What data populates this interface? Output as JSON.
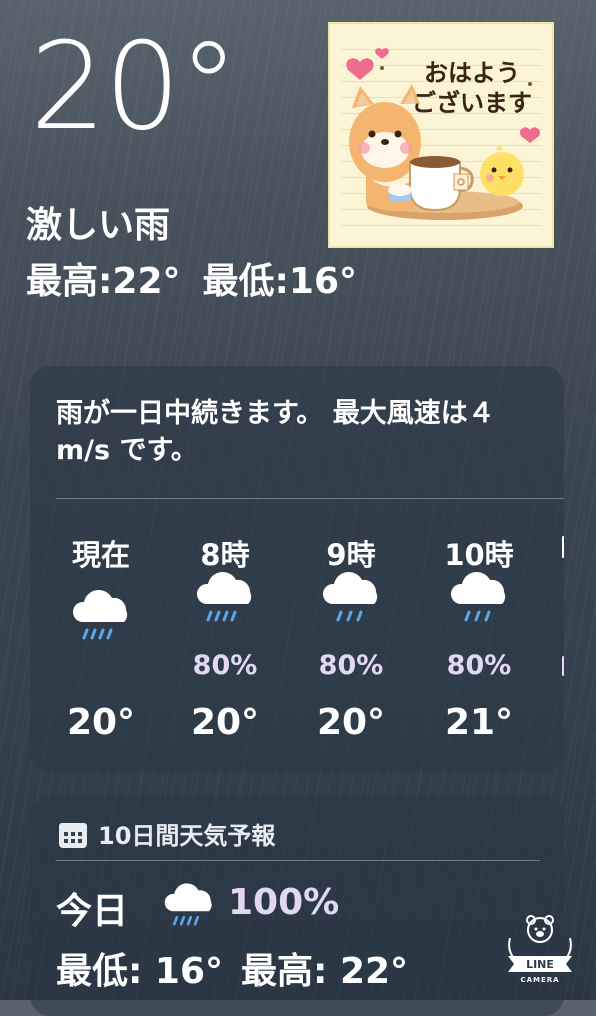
{
  "current": {
    "temperature": "20°",
    "condition": "激しい雨",
    "high": "最高:22°",
    "low": "最低:16°"
  },
  "sticker": {
    "line1": "おはよう",
    "line2": "ございます"
  },
  "summary": {
    "text": "雨が一日中続きます。 最大風速は４ m/s です。"
  },
  "hourly": [
    {
      "time": "現在",
      "icon": "rain-cloud-icon",
      "pop": "",
      "temp": "20°"
    },
    {
      "time": "8時",
      "icon": "rain-cloud-icon",
      "pop": "80%",
      "temp": "20°"
    },
    {
      "time": "9時",
      "icon": "rain-cloud-icon",
      "pop": "80%",
      "temp": "20°"
    },
    {
      "time": "10時",
      "icon": "rain-cloud-icon",
      "pop": "80%",
      "temp": "21°"
    }
  ],
  "daily": {
    "header": "10日間天気予報",
    "header_icon": "calendar-icon",
    "today": {
      "label": "今日",
      "icon": "rain-cloud-icon",
      "pop": "100%",
      "low": "最低: 16°",
      "high": "最高: 22°"
    }
  },
  "watermark": {
    "brand": "LINE",
    "sub": "CAMERA"
  },
  "colors": {
    "pop_text": "#e3d8f2",
    "rain_drops": "#5aa8ea",
    "card_bg": "rgba(42,54,68,0.55)"
  }
}
